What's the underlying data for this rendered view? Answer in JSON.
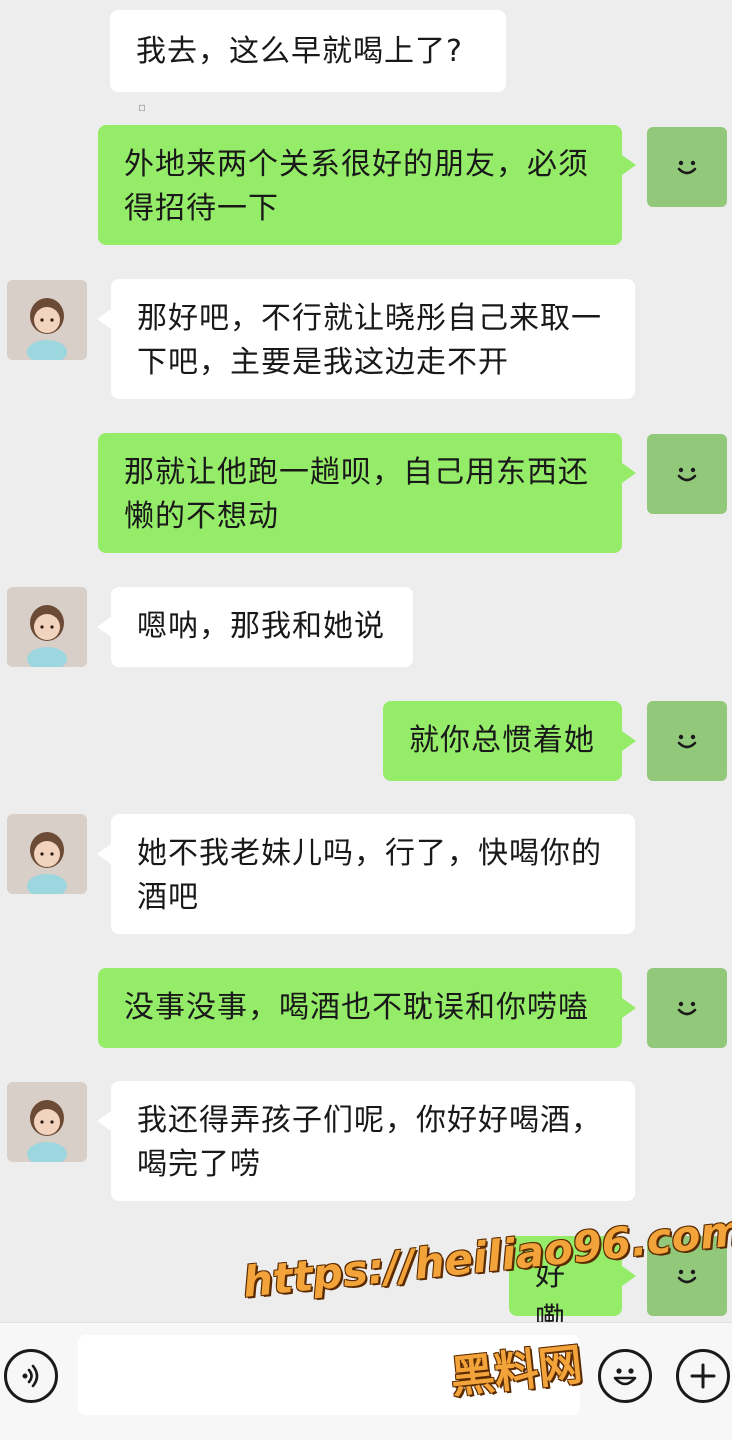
{
  "messages": [
    {
      "side": "in",
      "text": "我去，这么早就喝上了?"
    },
    {
      "side": "out",
      "text": "外地来两个关系很好的朋友，必须得招待一下"
    },
    {
      "side": "in",
      "text": "那好吧，不行就让晓彤自己来取一下吧，主要是我这边走不开"
    },
    {
      "side": "out",
      "text": "那就让他跑一趟呗，自己用东西还懒的不想动"
    },
    {
      "side": "in",
      "text": "嗯呐，那我和她说"
    },
    {
      "side": "out",
      "text": "就你总惯着她"
    },
    {
      "side": "in",
      "text": "她不我老妹儿吗，行了，快喝你的酒吧"
    },
    {
      "side": "out",
      "text": "没事没事，喝酒也不耽误和你唠嗑"
    },
    {
      "side": "in",
      "text": "我还得弄孩子们呢，你好好喝酒，喝完了唠"
    },
    {
      "side": "out",
      "text": "好嘞"
    }
  ],
  "input_bar": {
    "voice_icon": "voice-icon",
    "emoji_icon": "emoji-icon",
    "add_icon": "plus-icon",
    "input_value": ""
  },
  "watermark": {
    "url": "https://heiliao96.com",
    "name": "黑料网"
  },
  "colors": {
    "incoming_bubble": "#ffffff",
    "outgoing_bubble": "#95ec69",
    "background": "#ededed",
    "watermark": "#f2a33a"
  }
}
